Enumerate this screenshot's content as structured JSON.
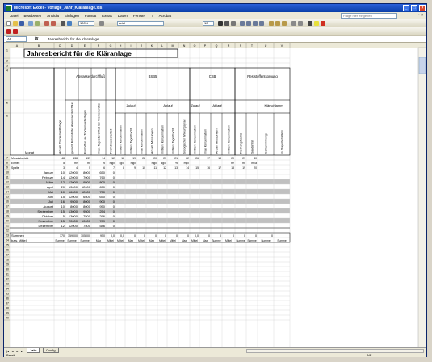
{
  "window": {
    "title": "Microsoft Excel - Vorlage_Jahr_Kläranlage.xls"
  },
  "menu": [
    "Datei",
    "Bearbeiten",
    "Ansicht",
    "Einfügen",
    "Format",
    "Extras",
    "Daten",
    "Fenster",
    "?",
    "Acrobat"
  ],
  "help_placeholder": "Frage hier eingeben",
  "toolbar": {
    "zoom": "100%",
    "font": "Arial",
    "size": "10"
  },
  "formula_bar": {
    "cell": "A1",
    "fx": "fx",
    "content": "Jahresbericht für die Kläranlage"
  },
  "sheet": {
    "title": "Jahresbericht für die Kläranlage",
    "columns": [
      "A",
      "B",
      "C",
      "D",
      "E",
      "F",
      "G",
      "H",
      "I",
      "J",
      "K",
      "L",
      "M",
      "N",
      "O",
      "P",
      "Q",
      "R",
      "S",
      "T",
      "U",
      "V"
    ],
    "group_headers": {
      "abwasser": "Abwasserdurchfluß",
      "bsb5": "BSB5",
      "csb": "CSB",
      "rest": "Reststoffentsorgung"
    },
    "sub_headers": {
      "zulauf": "Zulauf",
      "ablauf": "Ablauf",
      "klaer": "Klärschlamm"
    },
    "col_labels": {
      "C": "Anzahl Trockenwettertage",
      "D": "gesamt Behandelter Abwasserdurchfluß",
      "E": "Fremdfluß an Trockenwettertagen",
      "F": "max. Tagesdurchfluß bei Trockenwetter",
      "G": "Fremdwasseranteil",
      "H": "mittlere Konzentration",
      "I": "mittlere Tagesfracht",
      "J": "max Konzentration",
      "K": "Anzahl Messungen",
      "L": "mittlere Konzentration",
      "M": "mittlere Tagesfracht",
      "N": "biologischer Wirkungsgrad",
      "O": "mittlere Konzentration",
      "P": "max Konzentration",
      "Q": "Anzahl Messungen",
      "R": "mittlere Konzentration",
      "S": "Rechengutanfall",
      "T": "Sandanfall",
      "U": "Schlammmenge",
      "V": "in Stapelbehältern"
    },
    "monat": "Monat",
    "meta_rows": [
      {
        "label": "Monatsbericht",
        "vals": [
          "48",
          "138",
          "139",
          "14",
          "12",
          "18",
          "19",
          "22",
          "20",
          "23",
          "21",
          "22",
          "26",
          "17",
          "18",
          "20",
          "27",
          "30"
        ]
      },
      {
        "label": "Einheit",
        "vals": [
          "d",
          "m³",
          "m³",
          "%",
          "mg/l",
          "kg/d",
          "mg/l",
          "",
          "mg/l",
          "kg/d",
          "%",
          "mg/l",
          "",
          "",
          "",
          "m³",
          "m³",
          "m³/a"
        ]
      },
      {
        "label": "Spalte",
        "vals": [
          "3",
          "4",
          "5",
          "6",
          "7",
          "8",
          "9",
          "10",
          "11",
          "12",
          "13",
          "14",
          "15",
          "16",
          "17",
          "18",
          "19",
          "20"
        ]
      }
    ],
    "months": [
      {
        "name": "Januar",
        "c": "10",
        "d": "12000",
        "e": "8000",
        "f": "650",
        "g": "0",
        "shade": false
      },
      {
        "name": "Februar",
        "c": "14",
        "d": "12000",
        "e": "7000",
        "f": "760",
        "g": "0",
        "shade": false
      },
      {
        "name": "März",
        "c": "12",
        "d": "12000",
        "e": "9500",
        "f": "800",
        "g": "0",
        "shade": true
      },
      {
        "name": "April",
        "c": "20",
        "d": "13000",
        "e": "12000",
        "f": "650",
        "g": "0",
        "shade": false
      },
      {
        "name": "Mai",
        "c": "10",
        "d": "16000",
        "e": "12000",
        "f": "750",
        "g": "0",
        "shade": true
      },
      {
        "name": "Juni",
        "c": "15",
        "d": "12000",
        "e": "6500",
        "f": "650",
        "g": "0",
        "shade": false
      },
      {
        "name": "Juli",
        "c": "16",
        "d": "9500",
        "e": "8000",
        "f": "900",
        "g": "0",
        "shade": true
      },
      {
        "name": "August",
        "c": "10",
        "d": "8000",
        "e": "8000",
        "f": "950",
        "g": "0",
        "shade": false
      },
      {
        "name": "September",
        "c": "15",
        "d": "13000",
        "e": "9500",
        "f": "254",
        "g": "0",
        "shade": true
      },
      {
        "name": "Oktober",
        "c": "5",
        "d": "13000",
        "e": "7500",
        "f": "296",
        "g": "0",
        "shade": false
      },
      {
        "name": "November",
        "c": "15",
        "d": "20000",
        "e": "10000",
        "f": "789",
        "g": "0",
        "shade": true
      },
      {
        "name": "Dezember",
        "c": "12",
        "d": "12000",
        "e": "7500",
        "f": "586",
        "g": "0",
        "shade": false
      }
    ],
    "summen": {
      "label": "Summen",
      "vals": [
        "170",
        "159000",
        "105000",
        "950",
        "0,0",
        "0,0",
        "0",
        "0",
        "0",
        "0",
        "0",
        "0",
        "0,0",
        "0",
        "0",
        "0",
        "0",
        "0",
        "0"
      ]
    },
    "mittel": {
      "label": "bzw. Mittel",
      "vals": [
        "Summe",
        "Summe",
        "Summe",
        "Max",
        "Mittel",
        "Mittel",
        "Max",
        "Mittel",
        "Max",
        "Mittel",
        "Mittel",
        "Max",
        "Mittel",
        "Max",
        "Summe",
        "Mittel",
        "Summe",
        "Summe",
        "Summe",
        "Summe"
      ]
    }
  },
  "tabs": [
    "Jahr",
    "Config"
  ],
  "status": {
    "left": "Bereit",
    "right": "NF"
  }
}
